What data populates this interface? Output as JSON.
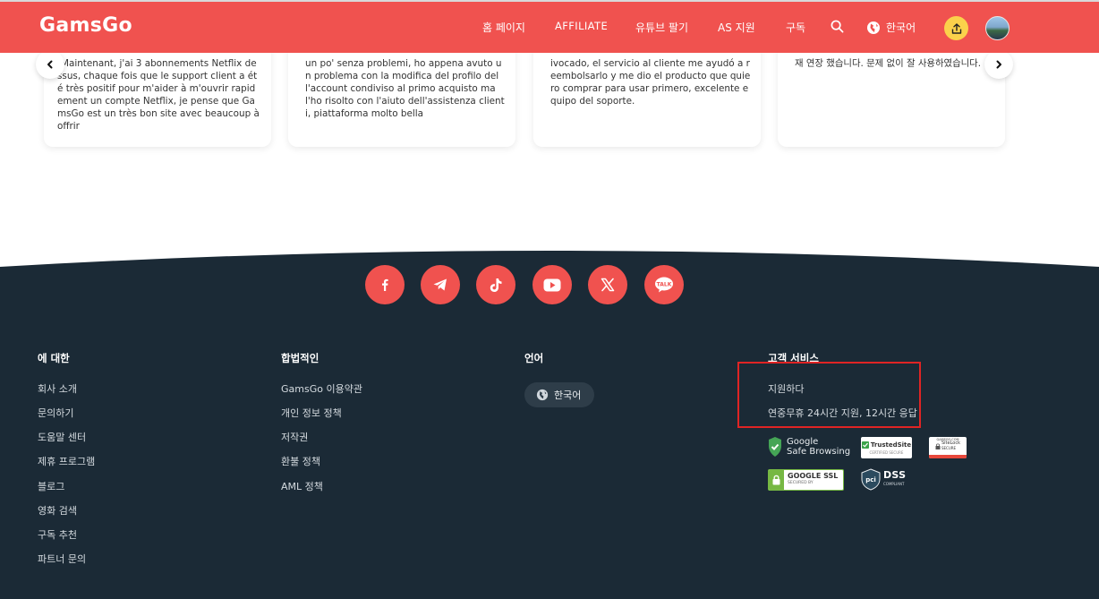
{
  "header": {
    "logo": "GamsGo",
    "nav": {
      "home": "홈 페이지",
      "affiliate": "AFFILIATE",
      "youtube": "유튜브 팔기",
      "support": "AS 지원",
      "subscribe": "구독",
      "language": "한국어"
    },
    "icons": [
      "search-icon",
      "globe-icon",
      "share-upload-icon",
      "avatar"
    ]
  },
  "reviews": [
    {
      "text": "Maintenant, j'ai 3 abonnements Netflix dessus, chaque fois que le support client a été très positif pour m'aider à m'ouvrir rapidement un compte Netflix, je pense que GamsGo est un très bon site avec beaucoup à offrir"
    },
    {
      "text": "un po' senza problemi, ho appena avuto un problema con la modifica del profilo dell'account condiviso al primo acquisto ma l'ho risolto con l'aiuto dell'assistenza clienti, piattaforma molto bella"
    },
    {
      "text": "ivocado, el servicio al cliente me ayudó a reembolsarlo y me dio el producto que quiero comprar para usar primero, excelente equipo del soporte."
    },
    {
      "text": "재 연장 했습니다. 문제 없이 잘 사용하였습니다."
    }
  ],
  "social": [
    "facebook-icon",
    "telegram-icon",
    "tiktok-icon",
    "youtube-icon",
    "x-icon",
    "kakaotalk-icon"
  ],
  "social_kakao_label": "TALK",
  "footer": {
    "about": {
      "title": "에 대한",
      "links": [
        "회사 소개",
        "문의하기",
        "도움말 센터",
        "제휴 프로그램",
        "블로그",
        "영화 검색",
        "구독 추천",
        "파트너 문의"
      ]
    },
    "legal": {
      "title": "합법적인",
      "links": [
        "GamsGo 이용약관",
        "개인 정보 정책",
        "저작권",
        "환불 정책",
        "AML 정책"
      ]
    },
    "language": {
      "title": "언어",
      "selected": "한국어"
    },
    "service": {
      "title": "고객 서비스",
      "links": [
        "지원하다",
        "연중무휴 24시간 지원, 12시간 응답"
      ]
    },
    "badges": {
      "google_line1": "Google",
      "google_line2": "Safe Browsing",
      "trusted": "TrustedSite",
      "trusted_sub": "CERTIFIED SECURE",
      "sitelock_top": "GAMSGO.COM",
      "sitelock": "SiteLock",
      "sitelock_sub": "SECURE",
      "ssl": "GOOGLE SSL",
      "ssl_sub": "SECURED BY",
      "pci": "DSS",
      "pci_prefix": "pci",
      "pci_sub": "COMPLIANT"
    }
  },
  "colors": {
    "brand": "#f0524f",
    "footer_bg": "#1b2a36",
    "highlight": "#e02424",
    "upload_btn": "#fbd14b"
  }
}
